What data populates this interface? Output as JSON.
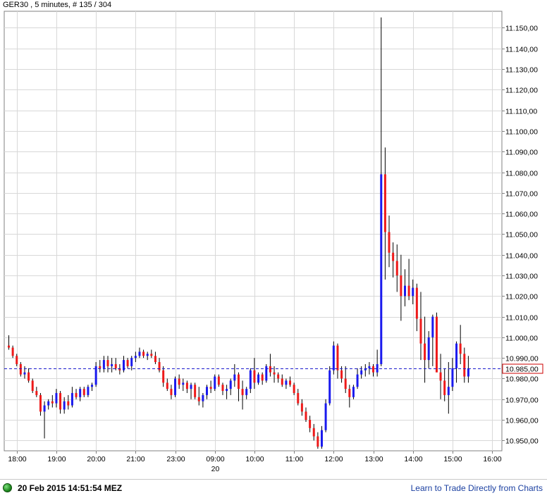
{
  "title": "GER30 , 5 minutes, # 135 / 304",
  "status": {
    "timestamp": "20 Feb 2015 14:51:54 MEZ",
    "link_text": "Learn to Trade Directly from Charts"
  },
  "colors": {
    "up": "#1a1aee",
    "down": "#ee1a1a",
    "wick": "#000000",
    "grid": "#d8d8d8",
    "current_line": "#1a1acc",
    "price_box": "#cc0000"
  },
  "chart_data": {
    "type": "candlestick",
    "current_price": 10985,
    "current_price_label": "10.985,00",
    "ylim": [
      10945,
      11158
    ],
    "y_ticks": [
      {
        "value": 10950,
        "label": "10.950,00"
      },
      {
        "value": 10960,
        "label": "10.960,00"
      },
      {
        "value": 10970,
        "label": "10.970,00"
      },
      {
        "value": 10980,
        "label": "10.980,00"
      },
      {
        "value": 10990,
        "label": "10.990,00"
      },
      {
        "value": 11000,
        "label": "11.000,00"
      },
      {
        "value": 11010,
        "label": "11.010,00"
      },
      {
        "value": 11020,
        "label": "11.020,00"
      },
      {
        "value": 11030,
        "label": "11.030,00"
      },
      {
        "value": 11040,
        "label": "11.040,00"
      },
      {
        "value": 11050,
        "label": "11.050,00"
      },
      {
        "value": 11060,
        "label": "11.060,00"
      },
      {
        "value": 11070,
        "label": "11.070,00"
      },
      {
        "value": 11080,
        "label": "11.080,00"
      },
      {
        "value": 11090,
        "label": "11.090,00"
      },
      {
        "value": 11100,
        "label": "11.100,00"
      },
      {
        "value": 11110,
        "label": "11.110,00"
      },
      {
        "value": 11120,
        "label": "11.120,00"
      },
      {
        "value": 11130,
        "label": "11.130,00"
      },
      {
        "value": 11140,
        "label": "11.140,00"
      },
      {
        "value": 11150,
        "label": "11.150,00"
      }
    ],
    "x_ticks": [
      {
        "index": 2,
        "label": "18:00"
      },
      {
        "index": 12,
        "label": "19:00"
      },
      {
        "index": 22,
        "label": "20:00"
      },
      {
        "index": 32,
        "label": "21:00"
      },
      {
        "index": 42,
        "label": "23:00"
      },
      {
        "index": 52,
        "label": "09:00",
        "sublabel": "20"
      },
      {
        "index": 62,
        "label": "10:00"
      },
      {
        "index": 72,
        "label": "11:00"
      },
      {
        "index": 82,
        "label": "12:00"
      },
      {
        "index": 92,
        "label": "13:00"
      },
      {
        "index": 102,
        "label": "14:00"
      },
      {
        "index": 112,
        "label": "15:00"
      },
      {
        "index": 122,
        "label": "16:00"
      }
    ],
    "candles": [
      {
        "o": 10996,
        "h": 11001,
        "l": 10994,
        "c": 10995
      },
      {
        "o": 10995,
        "h": 10996,
        "l": 10990,
        "c": 10991
      },
      {
        "o": 10991,
        "h": 10992,
        "l": 10986,
        "c": 10987
      },
      {
        "o": 10987,
        "h": 10988,
        "l": 10981,
        "c": 10982
      },
      {
        "o": 10982,
        "h": 10986,
        "l": 10980,
        "c": 10983
      },
      {
        "o": 10983,
        "h": 10985,
        "l": 10978,
        "c": 10979
      },
      {
        "o": 10979,
        "h": 10980,
        "l": 10973,
        "c": 10974
      },
      {
        "o": 10974,
        "h": 10976,
        "l": 10971,
        "c": 10972
      },
      {
        "o": 10972,
        "h": 10973,
        "l": 10962,
        "c": 10964
      },
      {
        "o": 10964,
        "h": 10969,
        "l": 10951,
        "c": 10967
      },
      {
        "o": 10967,
        "h": 10970,
        "l": 10965,
        "c": 10969
      },
      {
        "o": 10969,
        "h": 10972,
        "l": 10966,
        "c": 10968
      },
      {
        "o": 10968,
        "h": 10975,
        "l": 10966,
        "c": 10973
      },
      {
        "o": 10973,
        "h": 10974,
        "l": 10963,
        "c": 10965
      },
      {
        "o": 10965,
        "h": 10971,
        "l": 10963,
        "c": 10969
      },
      {
        "o": 10969,
        "h": 10972,
        "l": 10965,
        "c": 10967
      },
      {
        "o": 10967,
        "h": 10976,
        "l": 10966,
        "c": 10973
      },
      {
        "o": 10973,
        "h": 10975,
        "l": 10970,
        "c": 10971
      },
      {
        "o": 10971,
        "h": 10976,
        "l": 10969,
        "c": 10975
      },
      {
        "o": 10975,
        "h": 10976,
        "l": 10971,
        "c": 10972
      },
      {
        "o": 10972,
        "h": 10977,
        "l": 10971,
        "c": 10976
      },
      {
        "o": 10976,
        "h": 10978,
        "l": 10974,
        "c": 10977
      },
      {
        "o": 10977,
        "h": 10988,
        "l": 10976,
        "c": 10986
      },
      {
        "o": 10986,
        "h": 10989,
        "l": 10983,
        "c": 10985
      },
      {
        "o": 10985,
        "h": 10991,
        "l": 10983,
        "c": 10989
      },
      {
        "o": 10989,
        "h": 10991,
        "l": 10983,
        "c": 10986
      },
      {
        "o": 10986,
        "h": 10990,
        "l": 10983,
        "c": 10987
      },
      {
        "o": 10987,
        "h": 10990,
        "l": 10984,
        "c": 10985
      },
      {
        "o": 10985,
        "h": 10987,
        "l": 10982,
        "c": 10984
      },
      {
        "o": 10984,
        "h": 10991,
        "l": 10983,
        "c": 10989
      },
      {
        "o": 10989,
        "h": 10990,
        "l": 10985,
        "c": 10986
      },
      {
        "o": 10986,
        "h": 10991,
        "l": 10984,
        "c": 10990
      },
      {
        "o": 10990,
        "h": 10993,
        "l": 10988,
        "c": 10991
      },
      {
        "o": 10991,
        "h": 10995,
        "l": 10990,
        "c": 10993
      },
      {
        "o": 10993,
        "h": 10994,
        "l": 10990,
        "c": 10991
      },
      {
        "o": 10991,
        "h": 10993,
        "l": 10989,
        "c": 10992
      },
      {
        "o": 10992,
        "h": 10994,
        "l": 10990,
        "c": 10991
      },
      {
        "o": 10991,
        "h": 10993,
        "l": 10987,
        "c": 10988
      },
      {
        "o": 10988,
        "h": 10990,
        "l": 10983,
        "c": 10984
      },
      {
        "o": 10984,
        "h": 10986,
        "l": 10976,
        "c": 10978
      },
      {
        "o": 10978,
        "h": 10980,
        "l": 10974,
        "c": 10975
      },
      {
        "o": 10975,
        "h": 10977,
        "l": 10970,
        "c": 10972
      },
      {
        "o": 10972,
        "h": 10981,
        "l": 10971,
        "c": 10980
      },
      {
        "o": 10980,
        "h": 10982,
        "l": 10975,
        "c": 10977
      },
      {
        "o": 10977,
        "h": 10980,
        "l": 10974,
        "c": 10978
      },
      {
        "o": 10978,
        "h": 10979,
        "l": 10973,
        "c": 10975
      },
      {
        "o": 10975,
        "h": 10978,
        "l": 10970,
        "c": 10977
      },
      {
        "o": 10977,
        "h": 10978,
        "l": 10970,
        "c": 10971
      },
      {
        "o": 10971,
        "h": 10976,
        "l": 10967,
        "c": 10969
      },
      {
        "o": 10969,
        "h": 10973,
        "l": 10966,
        "c": 10972
      },
      {
        "o": 10972,
        "h": 10977,
        "l": 10970,
        "c": 10976
      },
      {
        "o": 10976,
        "h": 10979,
        "l": 10973,
        "c": 10975
      },
      {
        "o": 10975,
        "h": 10982,
        "l": 10974,
        "c": 10981
      },
      {
        "o": 10981,
        "h": 10982,
        "l": 10976,
        "c": 10977
      },
      {
        "o": 10977,
        "h": 10978,
        "l": 10972,
        "c": 10974
      },
      {
        "o": 10974,
        "h": 10977,
        "l": 10970,
        "c": 10975
      },
      {
        "o": 10975,
        "h": 10980,
        "l": 10972,
        "c": 10979
      },
      {
        "o": 10979,
        "h": 10987,
        "l": 10976,
        "c": 10982
      },
      {
        "o": 10982,
        "h": 10983,
        "l": 10969,
        "c": 10975
      },
      {
        "o": 10975,
        "h": 10979,
        "l": 10965,
        "c": 10972
      },
      {
        "o": 10972,
        "h": 10976,
        "l": 10970,
        "c": 10975
      },
      {
        "o": 10975,
        "h": 10985,
        "l": 10973,
        "c": 10984
      },
      {
        "o": 10984,
        "h": 10990,
        "l": 10975,
        "c": 10978
      },
      {
        "o": 10978,
        "h": 10983,
        "l": 10977,
        "c": 10982
      },
      {
        "o": 10982,
        "h": 10983,
        "l": 10977,
        "c": 10979
      },
      {
        "o": 10979,
        "h": 10987,
        "l": 10978,
        "c": 10986
      },
      {
        "o": 10986,
        "h": 10992,
        "l": 10981,
        "c": 10983
      },
      {
        "o": 10983,
        "h": 10986,
        "l": 10978,
        "c": 10982
      },
      {
        "o": 10982,
        "h": 10983,
        "l": 10978,
        "c": 10980
      },
      {
        "o": 10980,
        "h": 10982,
        "l": 10976,
        "c": 10977
      },
      {
        "o": 10977,
        "h": 10980,
        "l": 10975,
        "c": 10979
      },
      {
        "o": 10979,
        "h": 10981,
        "l": 10976,
        "c": 10977
      },
      {
        "o": 10977,
        "h": 10978,
        "l": 10972,
        "c": 10973
      },
      {
        "o": 10973,
        "h": 10975,
        "l": 10967,
        "c": 10968
      },
      {
        "o": 10968,
        "h": 10970,
        "l": 10962,
        "c": 10964
      },
      {
        "o": 10964,
        "h": 10966,
        "l": 10959,
        "c": 10960
      },
      {
        "o": 10960,
        "h": 10962,
        "l": 10954,
        "c": 10956
      },
      {
        "o": 10956,
        "h": 10958,
        "l": 10950,
        "c": 10952
      },
      {
        "o": 10952,
        "h": 10954,
        "l": 10946,
        "c": 10947
      },
      {
        "o": 10947,
        "h": 10957,
        "l": 10946,
        "c": 10955
      },
      {
        "o": 10955,
        "h": 10970,
        "l": 10954,
        "c": 10968
      },
      {
        "o": 10968,
        "h": 10986,
        "l": 10967,
        "c": 10984
      },
      {
        "o": 10984,
        "h": 10998,
        "l": 10982,
        "c": 10996
      },
      {
        "o": 10996,
        "h": 10997,
        "l": 10980,
        "c": 10984
      },
      {
        "o": 10984,
        "h": 10986,
        "l": 10978,
        "c": 10980
      },
      {
        "o": 10980,
        "h": 10986,
        "l": 10973,
        "c": 10975
      },
      {
        "o": 10975,
        "h": 10977,
        "l": 10966,
        "c": 10971
      },
      {
        "o": 10971,
        "h": 10977,
        "l": 10970,
        "c": 10976
      },
      {
        "o": 10976,
        "h": 10985,
        "l": 10975,
        "c": 10982
      },
      {
        "o": 10982,
        "h": 10986,
        "l": 10980,
        "c": 10984
      },
      {
        "o": 10984,
        "h": 10987,
        "l": 10981,
        "c": 10985
      },
      {
        "o": 10985,
        "h": 10988,
        "l": 10982,
        "c": 10986
      },
      {
        "o": 10986,
        "h": 10987,
        "l": 10981,
        "c": 10983
      },
      {
        "o": 10983,
        "h": 10994,
        "l": 10981,
        "c": 10987
      },
      {
        "o": 10987,
        "h": 11155,
        "l": 10986,
        "c": 11079
      },
      {
        "o": 11079,
        "h": 11092,
        "l": 11028,
        "c": 11051
      },
      {
        "o": 11051,
        "h": 11059,
        "l": 11034,
        "c": 11041
      },
      {
        "o": 11041,
        "h": 11046,
        "l": 11029,
        "c": 11037
      },
      {
        "o": 11037,
        "h": 11045,
        "l": 11022,
        "c": 11030
      },
      {
        "o": 11030,
        "h": 11040,
        "l": 11008,
        "c": 11020
      },
      {
        "o": 11020,
        "h": 11033,
        "l": 11015,
        "c": 11025
      },
      {
        "o": 11025,
        "h": 11038,
        "l": 11018,
        "c": 11020
      },
      {
        "o": 11020,
        "h": 11028,
        "l": 11016,
        "c": 11024
      },
      {
        "o": 11024,
        "h": 11026,
        "l": 11003,
        "c": 11009
      },
      {
        "o": 11009,
        "h": 11022,
        "l": 10989,
        "c": 10997
      },
      {
        "o": 10997,
        "h": 11010,
        "l": 10978,
        "c": 10989
      },
      {
        "o": 10989,
        "h": 11003,
        "l": 10985,
        "c": 11000
      },
      {
        "o": 11000,
        "h": 11011,
        "l": 10986,
        "c": 11010
      },
      {
        "o": 11010,
        "h": 11012,
        "l": 10989,
        "c": 10983
      },
      {
        "o": 10983,
        "h": 10992,
        "l": 10970,
        "c": 10979
      },
      {
        "o": 10979,
        "h": 10985,
        "l": 10969,
        "c": 10972
      },
      {
        "o": 10972,
        "h": 10988,
        "l": 10963,
        "c": 10976
      },
      {
        "o": 10976,
        "h": 10990,
        "l": 10974,
        "c": 10985
      },
      {
        "o": 10985,
        "h": 10998,
        "l": 10978,
        "c": 10997
      },
      {
        "o": 10997,
        "h": 11006,
        "l": 10987,
        "c": 10992
      },
      {
        "o": 10992,
        "h": 10995,
        "l": 10978,
        "c": 10981
      },
      {
        "o": 10981,
        "h": 10991,
        "l": 10978,
        "c": 10985
      }
    ]
  }
}
